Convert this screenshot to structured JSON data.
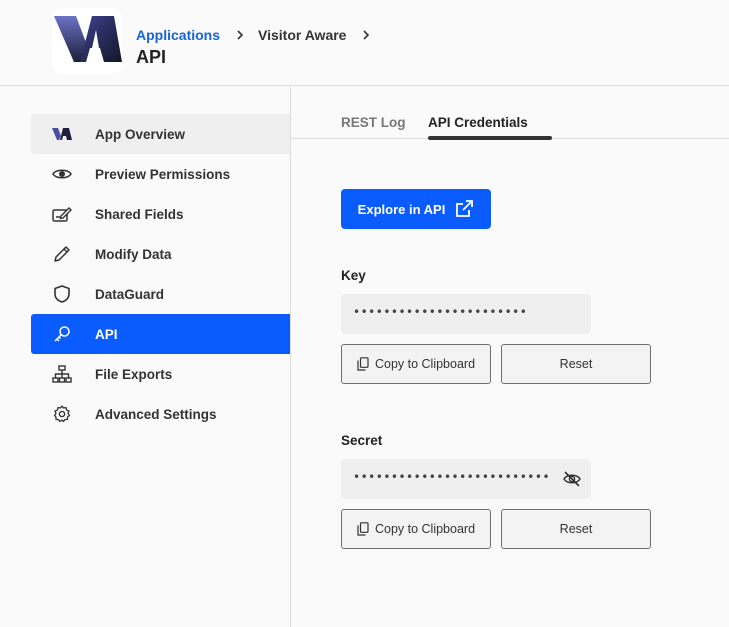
{
  "header": {
    "breadcrumb": [
      "Applications",
      "Visitor Aware"
    ],
    "title": "API"
  },
  "sidebar": {
    "items": [
      {
        "label": "App Overview",
        "icon": "va-logo-icon",
        "state": "hover"
      },
      {
        "label": "Preview Permissions",
        "icon": "eye-icon"
      },
      {
        "label": "Shared Fields",
        "icon": "shared-fields-icon"
      },
      {
        "label": "Modify Data",
        "icon": "pencil-icon"
      },
      {
        "label": "DataGuard",
        "icon": "shield-icon"
      },
      {
        "label": "API",
        "icon": "key-icon",
        "state": "active"
      },
      {
        "label": "File Exports",
        "icon": "sitemap-icon"
      },
      {
        "label": "Advanced Settings",
        "icon": "gear-icon"
      }
    ]
  },
  "tabs": [
    {
      "label": "REST Log",
      "active": false
    },
    {
      "label": "API Credentials",
      "active": true
    }
  ],
  "main": {
    "explore_label": "Explore in API",
    "key": {
      "label": "Key",
      "value": "•••••••••••••••••••••••",
      "copy_label": "Copy to Clipboard",
      "reset_label": "Reset"
    },
    "secret": {
      "label": "Secret",
      "value": "••••••••••••••••••••••••••",
      "copy_label": "Copy to Clipboard",
      "reset_label": "Reset"
    }
  },
  "colors": {
    "accent": "#0b5cff",
    "link": "#1565d8",
    "logo_dark": "#1e1f3d",
    "logo_purple": "#4a4f9e"
  }
}
